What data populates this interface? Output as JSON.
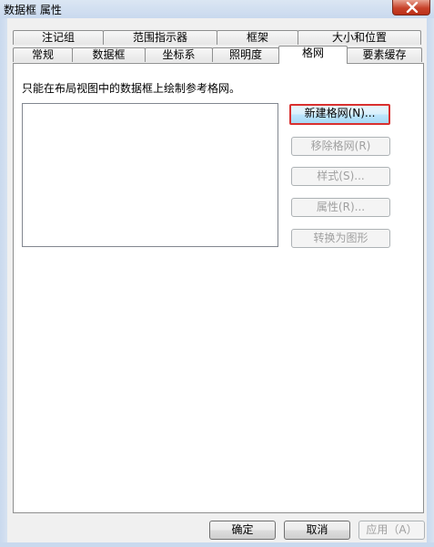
{
  "window": {
    "title": "数据框 属性"
  },
  "tabs_row1": [
    "注记组",
    "范围指示器",
    "框架",
    "大小和位置"
  ],
  "tabs_row2": [
    "常规",
    "数据框",
    "坐标系",
    "照明度",
    "格网",
    "要素缓存"
  ],
  "active_tab": "格网",
  "grids_panel": {
    "hint": "只能在布局视图中的数据框上绘制参考格网。",
    "new_grid": "新建格网(N)...",
    "remove_grid": "移除格网(R)",
    "style": "样式(S)...",
    "properties": "属性(R)...",
    "convert": "转换为图形"
  },
  "footer": {
    "ok": "确定",
    "cancel": "取消",
    "apply": "应用（A）"
  },
  "colors": {
    "focus_border": "#d9302f",
    "title_bar": "#c9d9ee",
    "close_button": "#c8432b"
  }
}
